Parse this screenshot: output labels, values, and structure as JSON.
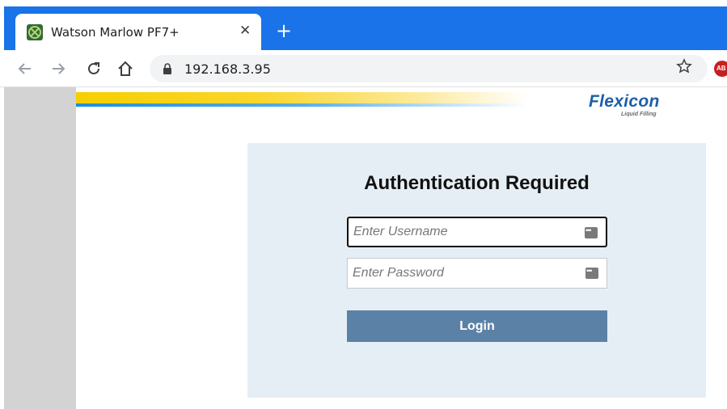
{
  "browser": {
    "tab_title": "Watson Marlow PF7+",
    "tab_close": "✕",
    "new_tab": "+",
    "url": "192.168.3.95",
    "extension_badge": "AB"
  },
  "icons": {
    "back": "back-arrow-icon",
    "forward": "forward-arrow-icon",
    "reload": "reload-icon",
    "home": "home-icon",
    "lock": "lock-icon",
    "bookmark": "star-icon",
    "password_key": "password-manager-icon"
  },
  "brand": {
    "logo_text": "Flexicon",
    "logo_subtitle": "Liquid Filling"
  },
  "login": {
    "title": "Authentication Required",
    "username_placeholder": "Enter Username",
    "password_placeholder": "Enter Password",
    "login_label": "Login"
  },
  "colors": {
    "chrome_accent": "#1a73e8",
    "card_background": "#e5eef4",
    "login_button": "#5b82a6",
    "logo_blue": "#1d5fa8"
  }
}
